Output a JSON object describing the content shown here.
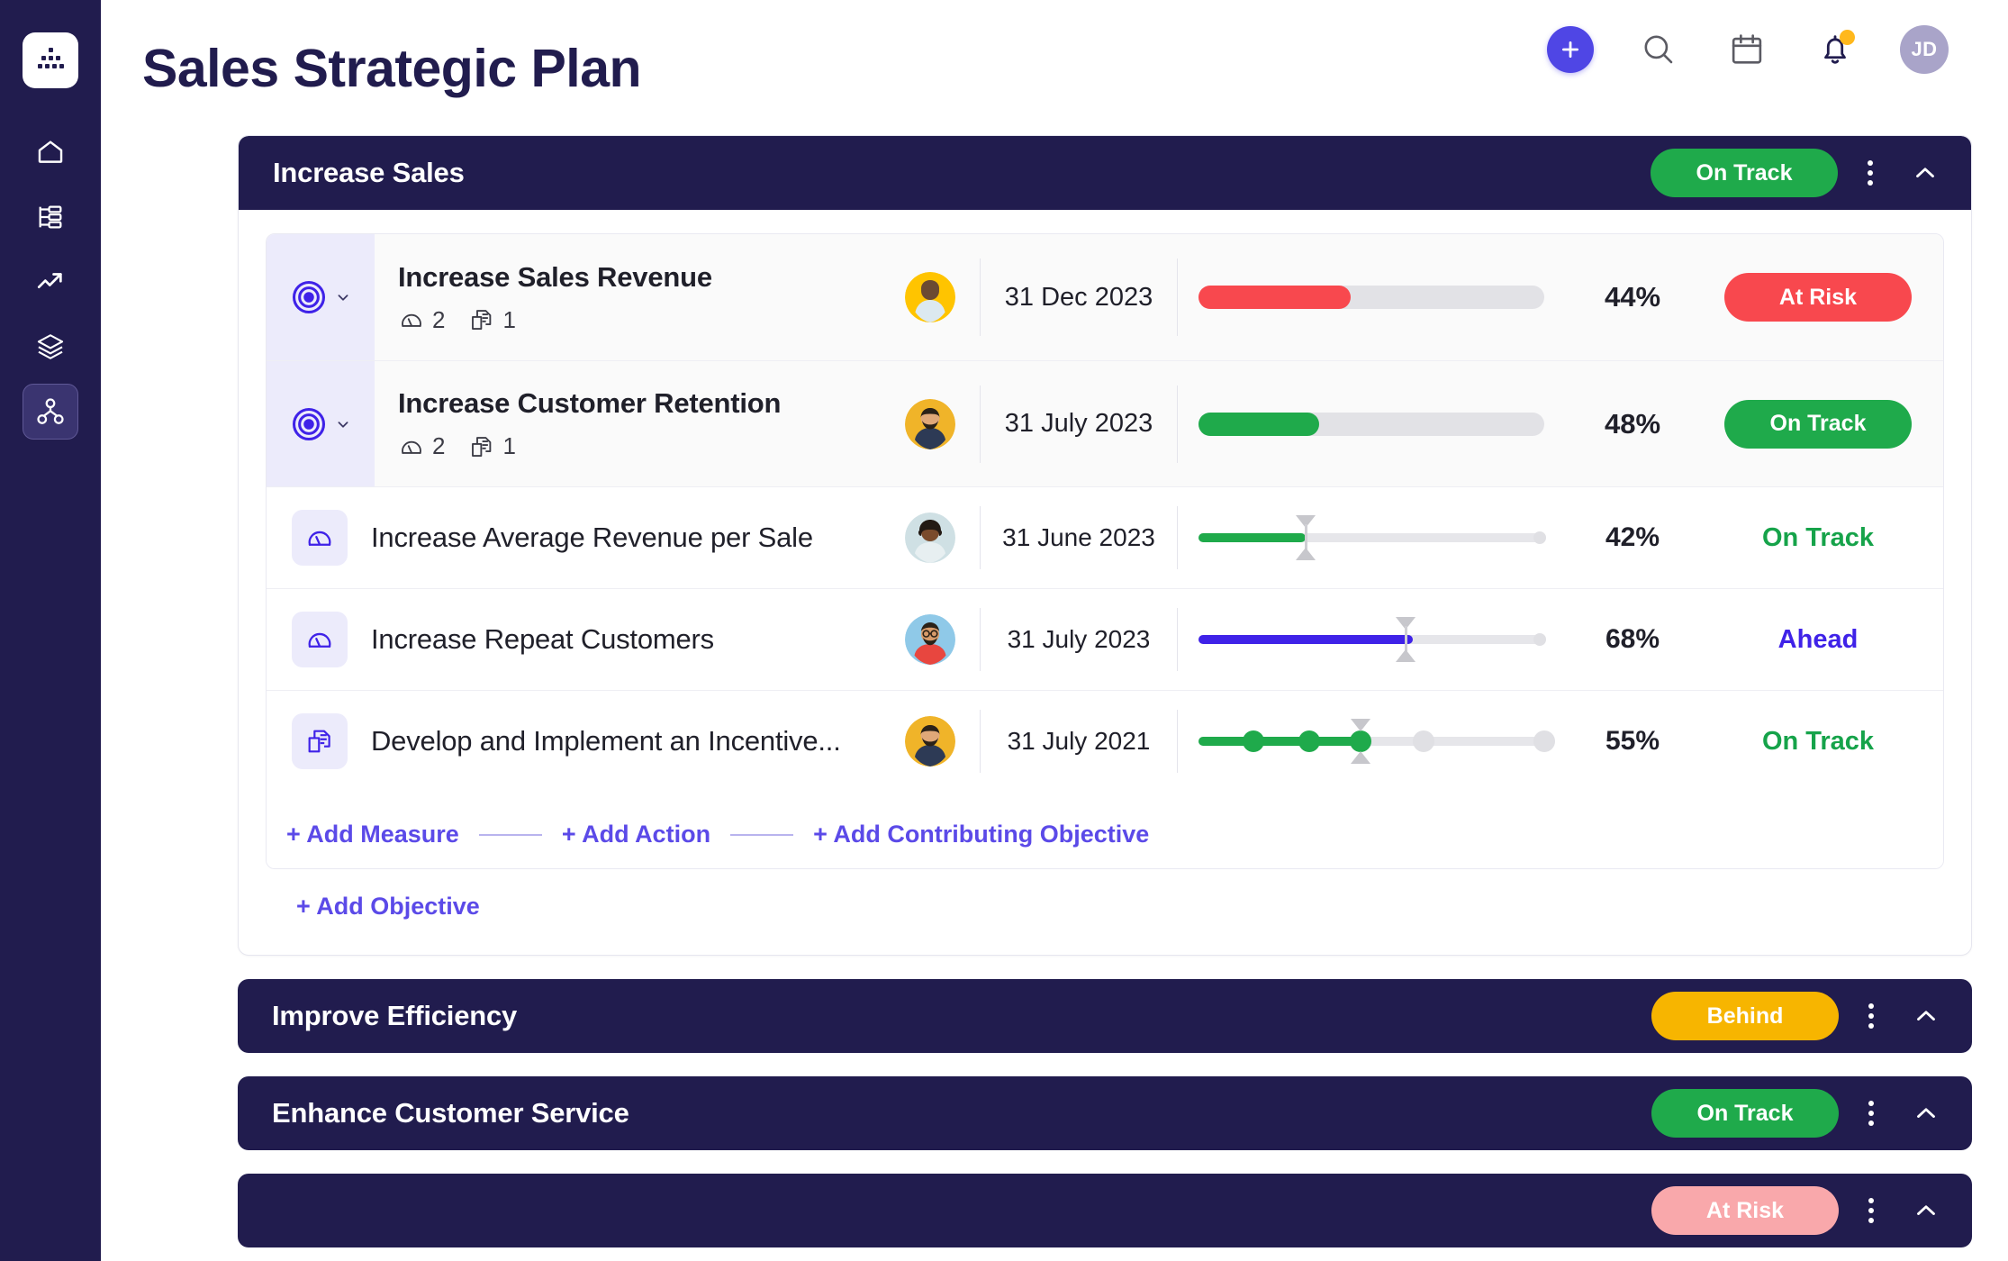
{
  "app": {
    "title": "Sales Strategic Plan",
    "user_initials": "JD"
  },
  "sidebar": {
    "items": [
      {
        "name": "logo",
        "icon": "org-chart-logo-icon"
      },
      {
        "name": "home",
        "icon": "home-icon"
      },
      {
        "name": "plans",
        "icon": "plan-list-icon"
      },
      {
        "name": "performance",
        "icon": "trending-up-icon"
      },
      {
        "name": "layers",
        "icon": "layers-icon"
      },
      {
        "name": "strategy-map",
        "icon": "network-nodes-icon"
      }
    ]
  },
  "topbar": {
    "add_label": "+",
    "icons": [
      "add-icon",
      "search-icon",
      "calendar-icon",
      "notifications-icon"
    ],
    "notification_badge": true
  },
  "accent": {
    "navy": "#211c4e",
    "indigo": "#4f46e5",
    "green": "#1faa4b",
    "red": "#f8484e",
    "amber": "#f7b500",
    "pink": "#f9a8ab",
    "link": "#5b4ae8"
  },
  "goals": [
    {
      "title": "Increase Sales",
      "status": "On Track",
      "status_class": "s-ontrack",
      "expanded": true,
      "rows": [
        {
          "type": "objective",
          "icon": "target-icon",
          "name": "Increase Sales Revenue",
          "measures_count": "2",
          "actions_count": "1",
          "avatar": "avatar-man-yellow",
          "date": "31 Dec 2023",
          "progress": 44,
          "percent": "44%",
          "bar_color": "#f8484e",
          "status": "At Risk",
          "status_style": "pill",
          "pill_class": "p-atrisk"
        },
        {
          "type": "objective",
          "icon": "target-icon",
          "name": "Increase Customer Retention",
          "measures_count": "2",
          "actions_count": "1",
          "avatar": "avatar-man-beard-yellow",
          "date": "31 July 2023",
          "progress": 35,
          "percent": "48%",
          "bar_color": "#1faa4b",
          "status": "On Track",
          "status_style": "pill",
          "pill_class": "p-ontrack"
        },
        {
          "type": "measure",
          "icon": "gauge-icon",
          "name": "Increase Average Revenue per Sale",
          "avatar": "avatar-woman-teal",
          "date": "31 June 2023",
          "progress": 31,
          "target_marker": 31,
          "percent": "42%",
          "bar_color": "#1faa4b",
          "status": "On Track",
          "status_style": "text",
          "text_class": "t-ontrack"
        },
        {
          "type": "measure",
          "icon": "gauge-icon",
          "name": "Increase Repeat Customers",
          "avatar": "avatar-man-glasses-red",
          "date": "31 July 2023",
          "progress": 62,
          "target_marker": 60,
          "percent": "68%",
          "bar_color": "#3f22e8",
          "status": "Ahead",
          "status_style": "text",
          "text_class": "t-ahead"
        },
        {
          "type": "action",
          "icon": "action-doc-icon",
          "name": "Develop and Implement an Incentive...",
          "avatar": "avatar-man-beard-yellow",
          "date": "31 July 2021",
          "progress": 47,
          "target_marker": 47,
          "percent": "55%",
          "bar_color": "#1faa4b",
          "milestones": [
            16,
            32,
            47,
            65,
            100
          ],
          "milestones_done": 3,
          "status": "On Track",
          "status_style": "text",
          "text_class": "t-ontrack"
        }
      ],
      "add_links": [
        "+ Add Measure",
        "+ Add Action",
        "+ Add Contributing Objective"
      ],
      "add_objective": "+ Add Objective"
    },
    {
      "title": "Improve Efficiency",
      "status": "Behind",
      "status_class": "s-behind",
      "expanded": false,
      "rows": []
    },
    {
      "title": "Enhance Customer Service",
      "status": "On Track",
      "status_class": "s-ontrack",
      "expanded": false,
      "rows": []
    },
    {
      "title": "",
      "status": "At Risk",
      "status_class": "s-atrisk",
      "expanded": false,
      "rows": []
    }
  ]
}
